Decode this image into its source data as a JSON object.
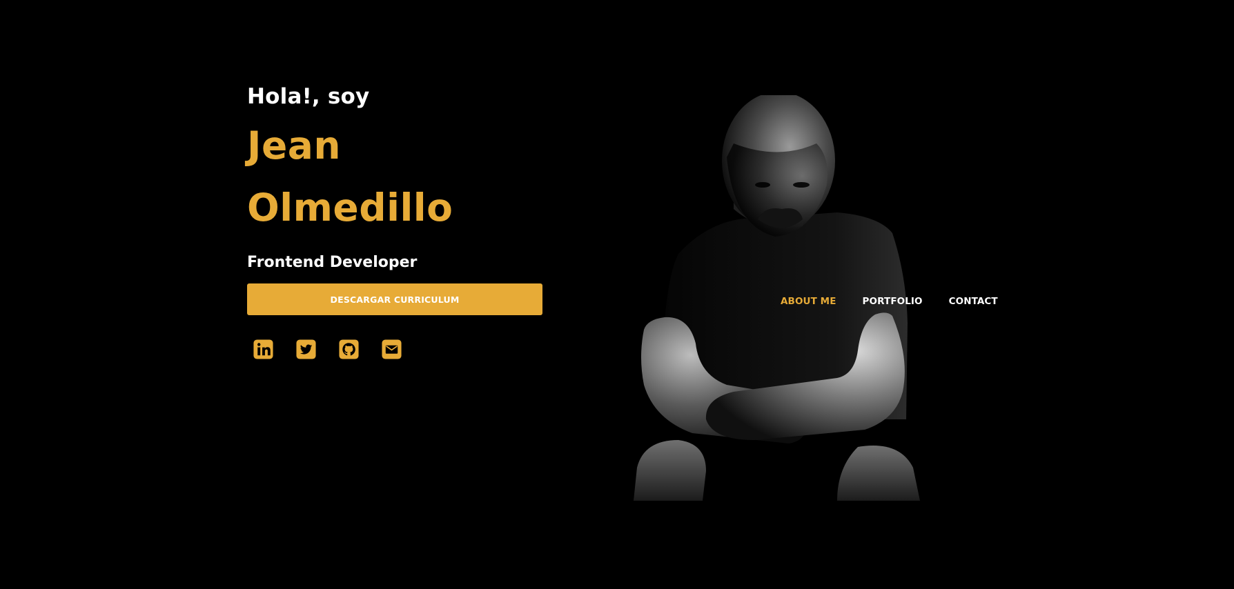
{
  "hero": {
    "greeting": "Hola!, soy",
    "first_name": "Jean",
    "last_name": "Olmedillo",
    "role": "Frontend Developer",
    "cv_button_label": "DESCARGAR CURRICULUM"
  },
  "socials": [
    {
      "name": "linkedin-icon",
      "label": "LinkedIn"
    },
    {
      "name": "twitter-icon",
      "label": "Twitter"
    },
    {
      "name": "github-icon",
      "label": "GitHub"
    },
    {
      "name": "email-icon",
      "label": "Email"
    }
  ],
  "nav": {
    "items": [
      {
        "label": "ABOUT ME",
        "active": true
      },
      {
        "label": "PORTFOLIO",
        "active": false
      },
      {
        "label": "CONTACT",
        "active": false
      }
    ]
  },
  "colors": {
    "accent": "#e7ab37",
    "background": "#000000",
    "text": "#ffffff"
  }
}
